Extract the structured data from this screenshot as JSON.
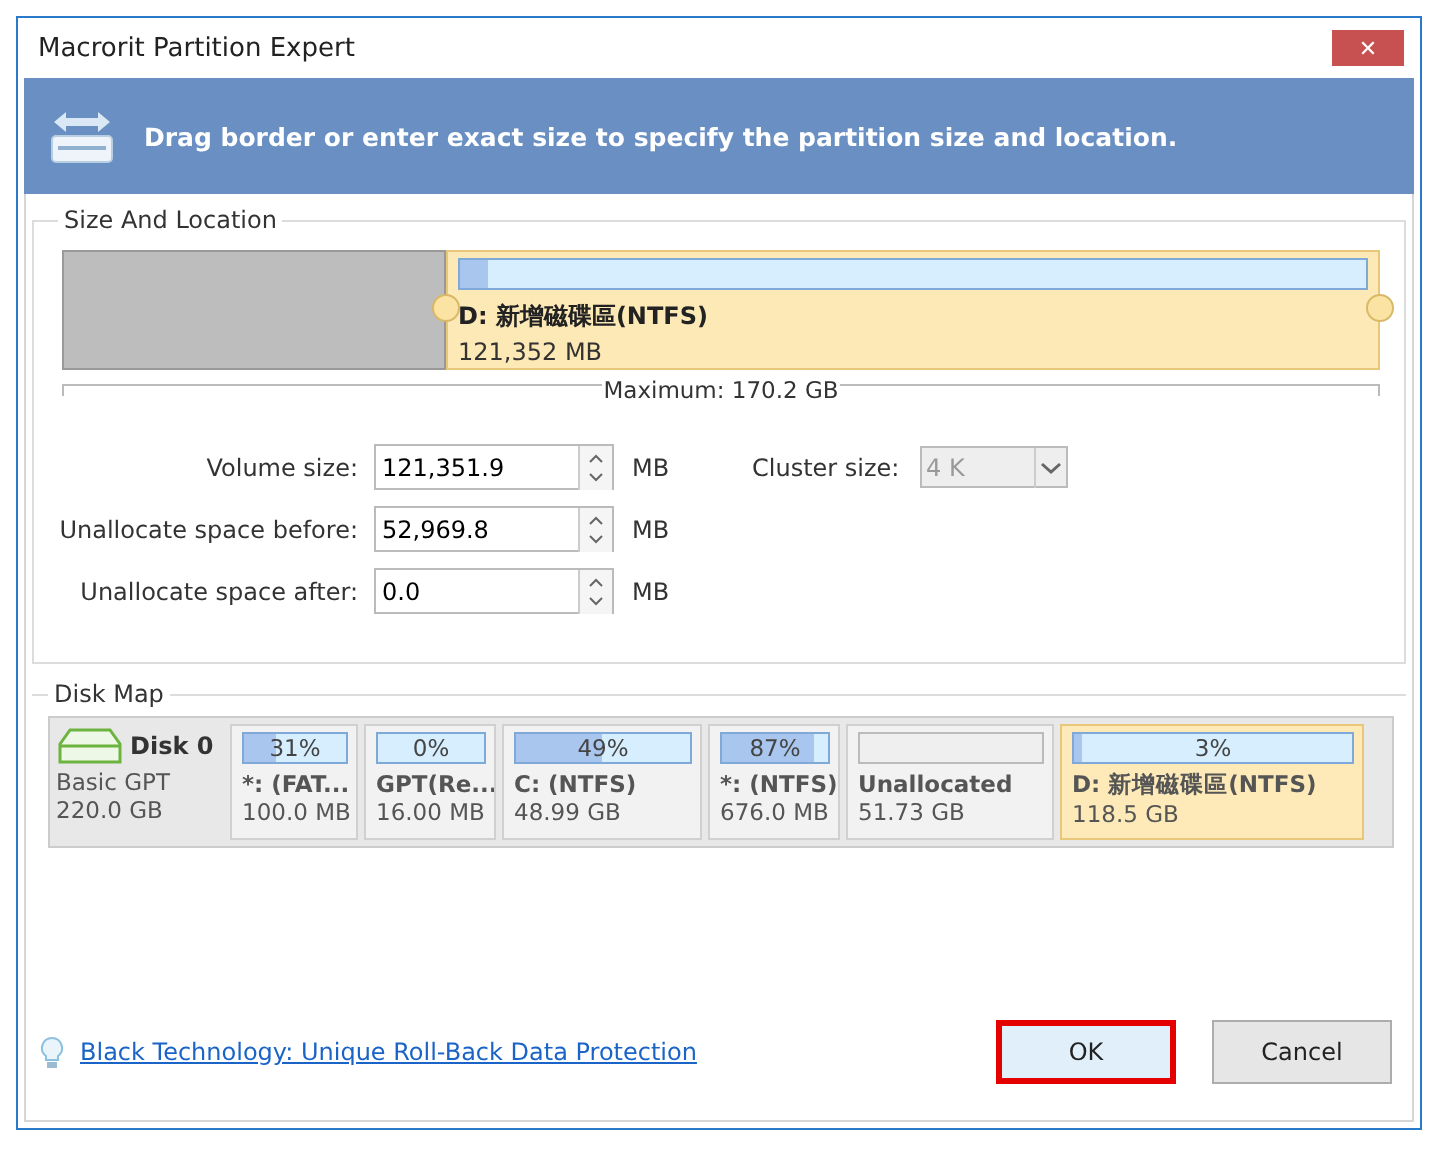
{
  "window": {
    "title": "Macrorit Partition Expert",
    "close": "✕"
  },
  "banner": {
    "text": "Drag border or enter exact size to specify the partition size and location."
  },
  "size_and_location": {
    "title": "Size And Location",
    "partition": {
      "name": "D: 新增磁碟區(NTFS)",
      "size": "121,352 MB",
      "level": 0.03
    },
    "maximum": "Maximum: 170.2 GB",
    "fields": [
      {
        "label": "Volume size:",
        "value": "121,351.9",
        "unit": "MB"
      },
      {
        "label": "Unallocate space before:",
        "value": "52,969.8",
        "unit": "MB"
      },
      {
        "label": "Unallocate space after:",
        "value": "0.0",
        "unit": "MB"
      }
    ],
    "cluster": {
      "label": "Cluster size:",
      "value": "4 K",
      "disabled": true
    }
  },
  "disk_map": {
    "title": "Disk Map",
    "disk": {
      "name": "Disk 0",
      "type": "Basic GPT",
      "size": "220.0 GB"
    },
    "partitions": [
      {
        "kind": "partition",
        "percent": "31%",
        "level": 0.31,
        "name": "*: (FAT...",
        "size": "100.0 MB",
        "selected": false
      },
      {
        "kind": "partition",
        "percent": "0%",
        "level": 0.0,
        "name": "GPT(Re...",
        "size": "16.00 MB",
        "selected": false
      },
      {
        "kind": "partition",
        "percent": "49%",
        "level": 0.49,
        "name": "C: (NTFS)",
        "size": "48.99 GB",
        "selected": false
      },
      {
        "kind": "partition",
        "percent": "87%",
        "level": 0.87,
        "name": "*: (NTFS)",
        "size": "676.0 MB",
        "selected": false
      },
      {
        "kind": "unallocated",
        "name": "Unallocated",
        "size": "51.73 GB",
        "selected": false
      },
      {
        "kind": "partition",
        "percent": "3%",
        "level": 0.03,
        "name": "D: 新增磁碟區(NTFS)",
        "size": "118.5 GB",
        "selected": true
      }
    ]
  },
  "footer": {
    "link": "Black Technology: Unique Roll-Back Data Protection",
    "buttons": [
      {
        "label": "OK",
        "highlighted": true
      },
      {
        "label": "Cancel",
        "highlighted": false
      }
    ]
  }
}
